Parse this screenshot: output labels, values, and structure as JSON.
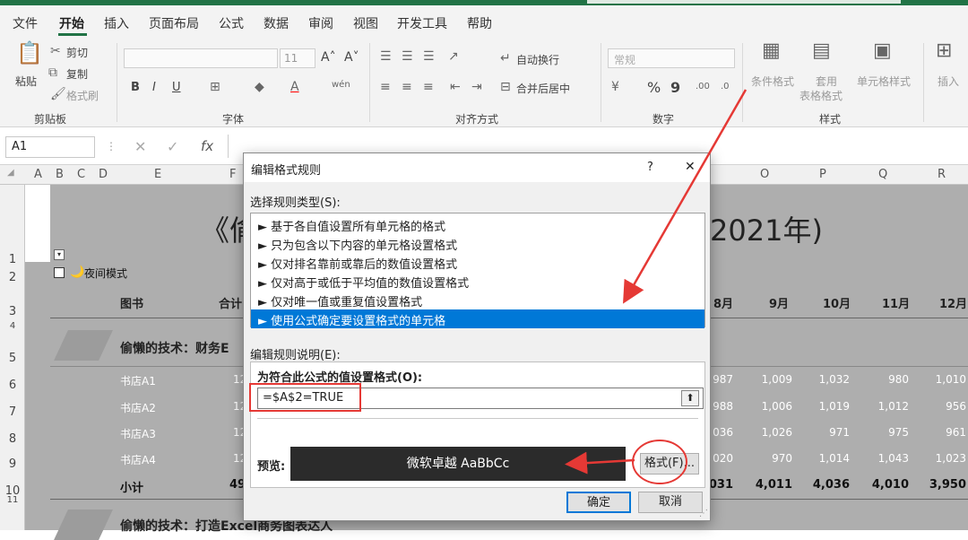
{
  "menu": [
    "文件",
    "开始",
    "插入",
    "页面布局",
    "公式",
    "数据",
    "审阅",
    "视图",
    "开发工具",
    "帮助"
  ],
  "ribbon": {
    "clipboard": {
      "paste": "粘贴",
      "cut": "剪切",
      "copy": "复制",
      "format_painter": "格式刷",
      "label": "剪贴板"
    },
    "font": {
      "size": "11",
      "bold": "B",
      "italic": "I",
      "underline": "U",
      "label": "字体"
    },
    "alignment": {
      "wrap": "自动换行",
      "merge": "合并后居中",
      "label": "对齐方式"
    },
    "number": {
      "format": "常规",
      "percent": "%",
      "comma": "9",
      "label": "数字"
    },
    "styles": {
      "conditional": "条件格式",
      "table": "套用",
      "table2": "表格格式",
      "cell_styles": "单元格样式",
      "label": "样式"
    },
    "cells": {
      "insert": "插入"
    }
  },
  "formula_bar": {
    "name_box": "A1",
    "fx": "fx"
  },
  "columns": [
    "A",
    "B",
    "C",
    "D",
    "E",
    "F",
    "O",
    "P",
    "Q",
    "R"
  ],
  "rows": [
    "1",
    "2",
    "3",
    "4",
    "5",
    "6",
    "7",
    "8",
    "9",
    "10",
    "11"
  ],
  "sheet": {
    "title_left": "《偷",
    "title_right": "2021年)",
    "checkbox_label": "夜间模式",
    "header_book": "图书",
    "header_total": "合计",
    "months": [
      "8月",
      "9月",
      "10月",
      "11月",
      "12月"
    ],
    "section1": "偷懒的技术：财务E",
    "section2": "偷懒的技术：打造Excel商务图表达人",
    "stores": [
      {
        "name": "书店A1",
        "total": "12",
        "vals": [
          "987",
          "1,009",
          "1,032",
          "980",
          "1,010"
        ]
      },
      {
        "name": "书店A2",
        "total": "12",
        "vals": [
          "988",
          "1,006",
          "1,019",
          "1,012",
          "956"
        ]
      },
      {
        "name": "书店A3",
        "total": "12",
        "vals": "036|1,026|971|975|961"
      },
      {
        "name": "书店A4",
        "total": "12",
        "vals": [
          "020",
          "970",
          "1,014",
          "1,043",
          "1,023"
        ]
      }
    ],
    "subtotal": {
      "name": "小计",
      "total": "49",
      "vals": [
        "031",
        "4,011",
        "4,036",
        "4,010",
        "3,950"
      ]
    }
  },
  "dialog": {
    "title": "编辑格式规则",
    "help": "?",
    "close": "✕",
    "select_type_label": "选择规则类型(S):",
    "rules": [
      "► 基于各自值设置所有单元格的格式",
      "► 只为包含以下内容的单元格设置格式",
      "► 仅对排名靠前或靠后的数值设置格式",
      "► 仅对高于或低于平均值的数值设置格式",
      "► 仅对唯一值或重复值设置格式",
      "► 使用公式确定要设置格式的单元格"
    ],
    "desc_label": "编辑规则说明(E):",
    "formula_label": "为符合此公式的值设置格式(O):",
    "formula_value": "=$A$2=TRUE",
    "preview_label": "预览:",
    "preview_text": "微软卓越  AaBbCc",
    "format_button": "格式(F)...",
    "ok": "确定",
    "cancel": "取消"
  },
  "colors": {
    "accent": "#217346",
    "selection": "#0078d7",
    "annotation": "#e53935"
  }
}
